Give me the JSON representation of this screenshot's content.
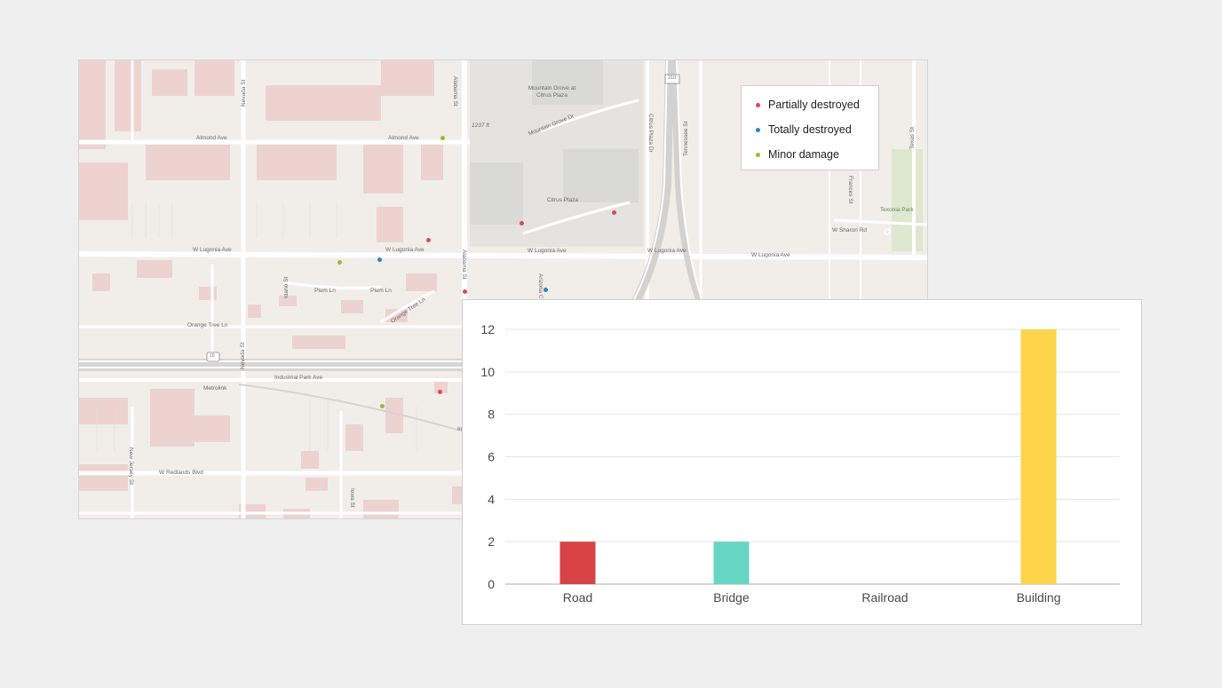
{
  "map": {
    "street_labels": {
      "nevada_st": "Nevada St",
      "alabama_st": "Alabama St",
      "almond_ave_w": "Almond Ave",
      "almond_ave_e": "Almond Ave",
      "elevation": "1237 ft",
      "mountain_grove": "Mountain Grove at Citrus Plaza",
      "mountain_grove_dr": "Mountain Grove Dr",
      "citrus_plaza_dr": "Citrus Plaza Dr",
      "tennessee_st": "Tennessee St",
      "texas_st": "Texas St",
      "citrus_plaza": "Citrus Plaza",
      "frances_st": "Frances St",
      "texonia_park": "Texonia Park",
      "w_sharon_rd": "W Sharon Rd",
      "w_lugonia_ave_1": "W Lugonia Ave",
      "w_lugonia_ave_2": "W Lugonia Ave",
      "w_lugonia_ave_3": "W Lugonia Ave",
      "w_lugonia_ave_4": "W Lugonia Ave",
      "w_lugonia_ave_5": "W Lugonia Ave",
      "idaho_st": "Idaho St",
      "plum_ln_1": "Plum Ln",
      "plum_ln_2": "Plum Ln",
      "orange_tree_ln_1": "Orange Tree Ln",
      "orange_tree_ln_2": "Orange Tree Ln",
      "arizona_ct": "Arizona Ct",
      "industrial_park_ave": "Industrial Park Ave",
      "metrolink": "Metrolink",
      "new_jersey_st": "New Jersey St",
      "w_redlands_blvd": "W Redlands Blvd",
      "iowa_st": "Iowa St",
      "nevada_st_2": "Nevada St",
      "hwy_10": "10",
      "hwy_210": "210",
      "in_cut": "In"
    },
    "legend": {
      "items": [
        {
          "label": "Partially destroyed",
          "color": "#e0475a"
        },
        {
          "label": "Totally destroyed",
          "color": "#2f86b8"
        },
        {
          "label": "Minor damage",
          "color": "#a3b43a"
        }
      ]
    },
    "markers": [
      {
        "category": "Minor damage",
        "color": "#a3b43a"
      },
      {
        "category": "Partially destroyed",
        "color": "#e0475a"
      },
      {
        "category": "Minor damage",
        "color": "#a3b43a"
      },
      {
        "category": "Totally destroyed",
        "color": "#2f86b8"
      },
      {
        "category": "Partially destroyed",
        "color": "#e0475a"
      },
      {
        "category": "Totally destroyed",
        "color": "#2f86b8"
      },
      {
        "category": "Partially destroyed",
        "color": "#e0475a"
      },
      {
        "category": "Partially destroyed",
        "color": "#e0475a"
      },
      {
        "category": "Partially destroyed",
        "color": "#e0475a"
      },
      {
        "category": "Minor damage",
        "color": "#a3b43a"
      }
    ]
  },
  "chart_data": {
    "type": "bar",
    "categories": [
      "Road",
      "Bridge",
      "Railroad",
      "Building"
    ],
    "values": [
      2,
      2,
      0,
      12
    ],
    "colors": [
      "#d74345",
      "#67d7c3",
      "#cccccc",
      "#fcd54b"
    ],
    "yticks": [
      "0",
      "2",
      "4",
      "6",
      "8",
      "10",
      "12"
    ],
    "ylim": [
      0,
      12
    ],
    "grid": true,
    "title": "",
    "xlabel": "",
    "ylabel": ""
  }
}
